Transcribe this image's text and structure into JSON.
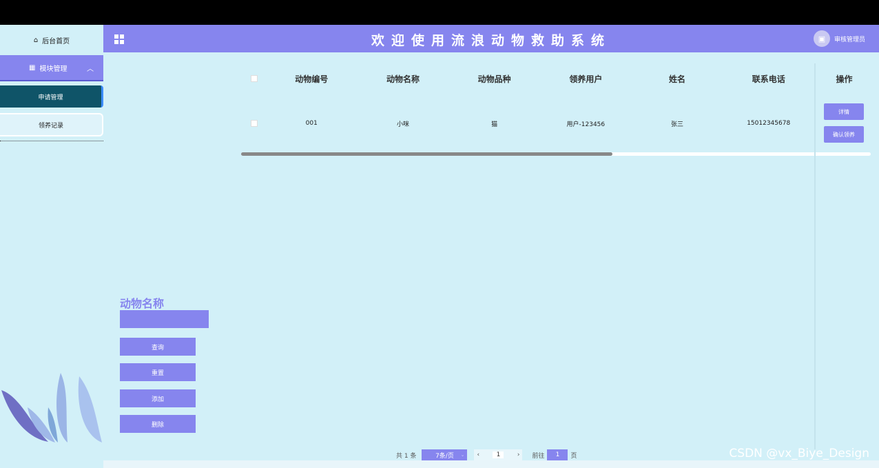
{
  "sidebar": {
    "home_label": "后台首页",
    "module_label": "模块管理",
    "items": [
      {
        "label": "申请管理"
      },
      {
        "label": "领养记录"
      }
    ]
  },
  "header": {
    "title": "欢迎使用流浪动物救助系统",
    "user_label": "审核管理员"
  },
  "table": {
    "columns": [
      "动物编号",
      "动物名称",
      "动物品种",
      "领养用户",
      "姓名",
      "联系电话"
    ],
    "ops_header": "操作",
    "rows": [
      {
        "cells": [
          "001",
          "小咪",
          "猫",
          "用户-123456",
          "张三",
          "15012345678"
        ],
        "actions": [
          "详情",
          "确认领养"
        ]
      }
    ],
    "scroll_fraction": 0.59
  },
  "search": {
    "label": "动物名称",
    "value": "",
    "buttons": [
      "查询",
      "重置",
      "添加",
      "删除"
    ]
  },
  "pagination": {
    "total": "共 1 条",
    "page_size": "7条/页",
    "current": "1",
    "goto_prefix": "前往",
    "goto_value": "1",
    "goto_suffix": "页"
  },
  "watermark": "CSDN @vx_Biye_Design",
  "colors": {
    "accent": "#8685ee",
    "background": "#d2f0f8",
    "active_item": "#0f5468"
  }
}
